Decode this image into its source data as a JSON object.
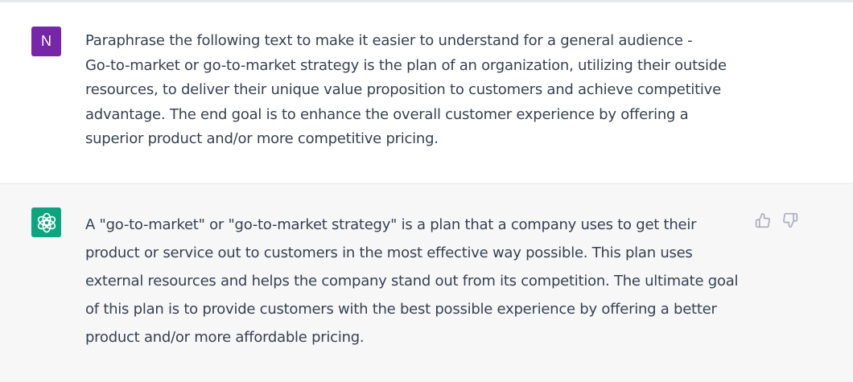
{
  "user_message": {
    "avatar_initial": "N",
    "text": "Paraphrase the following text to make it easier to understand for a general audience -\nGo-to-market or go-to-market strategy is the plan of an organization, utilizing their outside\nresources, to deliver their unique value proposition to customers and achieve competitive\nadvantage. The end goal is to enhance the overall customer experience by offering a\nsuperior product and/or more competitive pricing."
  },
  "assistant_message": {
    "avatar_icon": "openai-logo-icon",
    "text": "A \"go-to-market\" or \"go-to-market strategy\" is a plan that a company uses to get their\nproduct or service out to customers in the most effective way possible. This plan uses\nexternal resources and helps the company stand out from its competition. The ultimate goal\nof this plan is to provide customers with the best possible experience by offering a better\nproduct and/or more affordable pricing."
  },
  "feedback": {
    "like_icon": "thumbs-up-icon",
    "dislike_icon": "thumbs-down-icon"
  },
  "colors": {
    "user_avatar": "#7527a8",
    "assistant_avatar": "#10a37f",
    "assistant_bg": "#f7f7f8",
    "text": "#374151"
  }
}
